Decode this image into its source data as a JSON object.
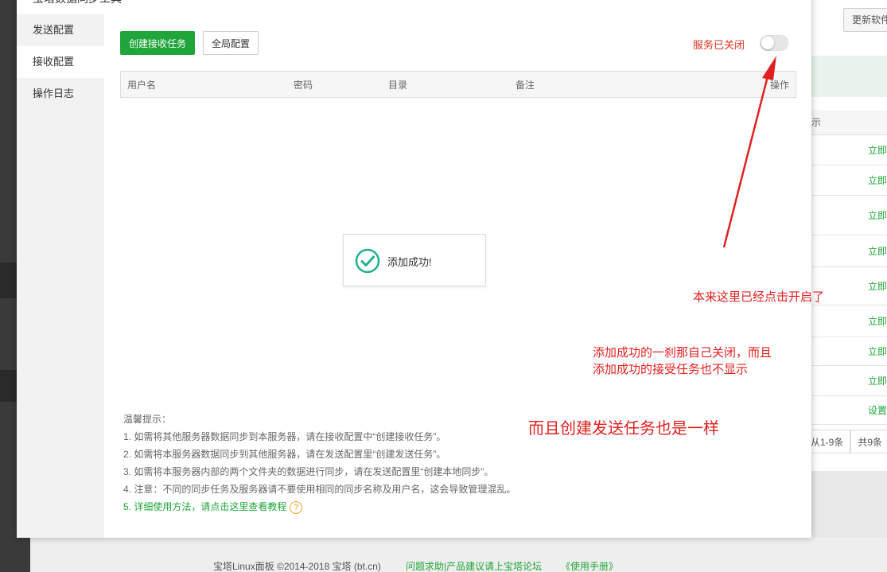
{
  "modal": {
    "title": "宝塔数据同步工具",
    "sidebar": {
      "items": [
        {
          "label": "发送配置",
          "active": false
        },
        {
          "label": "接收配置",
          "active": true
        },
        {
          "label": "操作日志",
          "active": false
        }
      ]
    },
    "toolbar": {
      "create_label": "创建接收任务",
      "global_label": "全局配置"
    },
    "service": {
      "status_label": "服务已关闭",
      "enabled": false
    },
    "table": {
      "headers": [
        "用户名",
        "密码",
        "目录",
        "备注",
        "操作"
      ]
    },
    "toast": {
      "message": "添加成功!"
    },
    "tips": {
      "title": "温馨提示：",
      "items": [
        "1. 如需将其他服务器数据同步到本服务器，请在接收配置中“创建接收任务”。",
        "2. 如需将本服务器数据同步到其他服务器，请在发送配置里“创建发送任务”。",
        "3. 如需将本服务器内部的两个文件夹的数据进行同步，请在发送配置里“创建本地同步”。",
        "4. 注意：不同的同步任务及服务器请不要使用相同的同步名称及用户名，这会导致管理混乱。"
      ],
      "link_prefix": "5. ",
      "link_text": "详细使用方法，请点击这里查看教程",
      "help_glyph": "?"
    }
  },
  "background": {
    "update_button": "更新软件",
    "table_header_fragment": "示",
    "rows": [
      "立即",
      "立即",
      "立即",
      "立即",
      "立即",
      "立即",
      "立即",
      "立即",
      "设置"
    ],
    "pager": {
      "range": "从1-9条",
      "total": "共9条"
    },
    "footer": {
      "copyright": "宝塔Linux面板 ©2014-2018 宝塔 (bt.cn)",
      "forum_link": "问题求助|产品建议请上宝塔论坛",
      "manual_link": "《使用手册》"
    }
  },
  "annotations": {
    "note1": "本来这里已经点击开启了",
    "note2_line1": "添加成功的一刹那自己关闭，而且",
    "note2_line2": "添加成功的接受任务也不显示",
    "note3": "而且创建发送任务也是一样"
  },
  "colors": {
    "brand_green": "#20a53a",
    "annotation_red": "#e02020",
    "status_red": "#dd3322"
  }
}
